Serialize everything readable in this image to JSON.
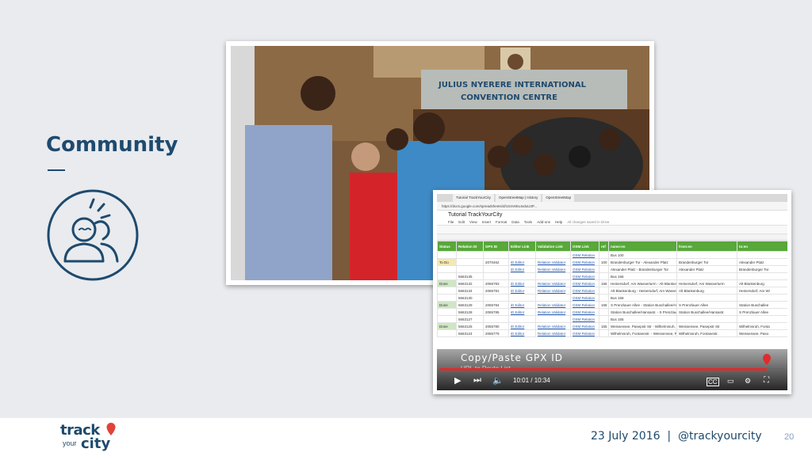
{
  "slide": {
    "title": "Community",
    "colors": {
      "accent": "#1e4a6e",
      "background": "#e9ebee"
    }
  },
  "photo": {
    "building_sign_line1": "JULIUS NYERERE INTERNATIONAL",
    "building_sign_line2": "CONVENTION CENTRE"
  },
  "spreadsheet": {
    "tabs": [
      "Tutorial TrackYourCity",
      "OpenStreetMap | History",
      "OpenStreetMap"
    ],
    "url": "https://docs.google.com/spreadsheets/d/1S4VeEuIxduU3P...",
    "doc_title": "Tutorial TrackYourCity",
    "menu": [
      "File",
      "Edit",
      "View",
      "Insert",
      "Format",
      "Data",
      "Tools",
      "Add-ons",
      "Help",
      "All changes saved in Drive"
    ],
    "headers": [
      "Status",
      "Relation ID",
      "GPX ID",
      "Editor Link",
      "Validation Link",
      "OSM Link",
      "ref",
      "name:en",
      "from:en",
      "to:en"
    ],
    "rows": [
      [
        "",
        "",
        "",
        "",
        "",
        "OSM Relation",
        "",
        "Bus 100",
        "",
        ""
      ],
      [
        "To Do",
        "",
        "2070462",
        "iD Editor",
        "Relation Validator",
        "OSM Relation",
        "100",
        "Brandenburger Tor - Alexander Platz",
        "Brandenburger Tor",
        "Alexander Platz"
      ],
      [
        "",
        "",
        "",
        "iD Editor",
        "Relation Validator",
        "OSM Relation",
        "",
        "Alexander Platz - Brandenburger Tor",
        "Alexander Platz",
        "Brandenburger Tor"
      ],
      [
        "",
        "5663135",
        "",
        "",
        "",
        "OSM Relation",
        "",
        "Bus 156",
        "",
        ""
      ],
      [
        "Done",
        "5663132",
        "2065783",
        "iD Editor",
        "Relation Validator",
        "OSM Relation",
        "156",
        "Heinersdorf, Am Wasserturm - Alt Blankenburg",
        "Heinersdorf, Am Wasserturm",
        "Alt Blankenburg"
      ],
      [
        "",
        "5663134",
        "2065781",
        "iD Editor",
        "Relation Validator",
        "OSM Relation",
        "",
        "Alt Blankenburg - Heinersdorf, Am Wasserturm",
        "Alt Blankenburg",
        "Heinersdorf, Am Wi"
      ],
      [
        "",
        "5663130",
        "",
        "",
        "",
        "OSM Relation",
        "",
        "Bus 158",
        "",
        ""
      ],
      [
        "Done",
        "5663129",
        "2065784",
        "iD Editor",
        "Relation Validator",
        "OSM Relation",
        "158",
        "S Prenzlauer Allee - Station Buschallee/Hansastr.",
        "S Prenzlauer Allee",
        "Station Buschallee"
      ],
      [
        "",
        "5663128",
        "2065785",
        "iD Editor",
        "Relation Validator",
        "OSM Relation",
        "",
        "Station Buschallee/Hansastr. - S Prenzlauer Allee",
        "Station Buschallee/Hansastr.",
        "S Prenzlauer Allee"
      ],
      [
        "",
        "5663127",
        "",
        "",
        "",
        "OSM Relation",
        "",
        "Bus 155",
        "",
        ""
      ],
      [
        "Done",
        "5663125",
        "2065780",
        "iD Editor",
        "Relation Validator",
        "OSM Relation",
        "155",
        "Weissensee, Pasepstr Str - Wilhelmsruh, Fontanestr.",
        "Weissensee, Pasepstr Str",
        "Wilhelmsruh, Fonta"
      ],
      [
        "",
        "5663124",
        "2065779",
        "iD Editor",
        "Relation Validator",
        "OSM Relation",
        "",
        "Wilhelmsruh, Fontanestr. - Weissensee, Pasepstr Str",
        "Wilhelmsruh, Fontanestr.",
        "Weissensee, Paso"
      ]
    ]
  },
  "video": {
    "title": "Copy/Paste GPX ID",
    "subtitle": "URL to Route List",
    "time": "10:01 / 10:34",
    "progress": 0.95
  },
  "footer": {
    "logo_track": "track",
    "logo_your": "your",
    "logo_city": "city",
    "date_handle": "23 July 2016  |  @trackyourcity",
    "page_number": "20"
  }
}
